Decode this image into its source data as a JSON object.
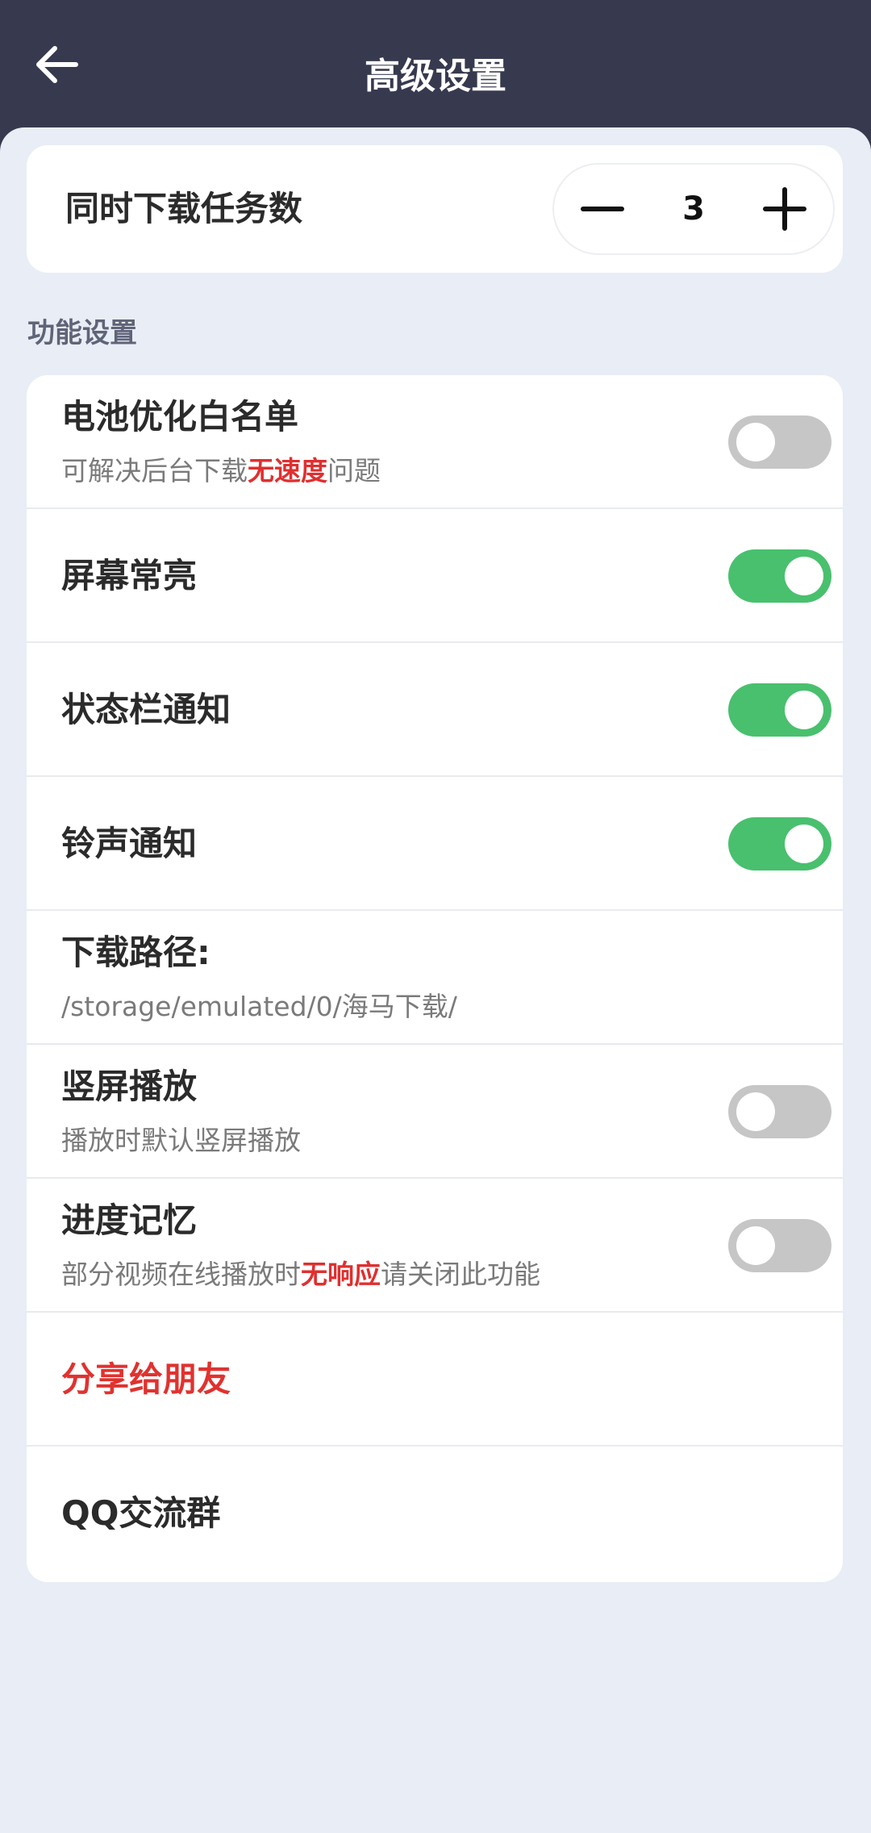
{
  "appbar": {
    "title": "高级设置",
    "back_icon": "arrow-left-icon"
  },
  "concurrent": {
    "label": "同时下载任务数",
    "value": "3",
    "minus_icon": "minus-icon",
    "plus_icon": "plus-icon"
  },
  "section": {
    "title": "功能设置"
  },
  "settings": {
    "battery": {
      "title": "电池优化白名单",
      "sub_before": "可解决后台下载",
      "sub_highlight": "无速度",
      "sub_after": "问题",
      "enabled": false
    },
    "screen_on": {
      "title": "屏幕常亮",
      "enabled": true
    },
    "statusbar": {
      "title": "状态栏通知",
      "enabled": true
    },
    "ringtone": {
      "title": "铃声通知",
      "enabled": true
    },
    "download_path": {
      "title": "下载路径:",
      "value": "/storage/emulated/0/海马下载/"
    },
    "portrait": {
      "title": "竖屏播放",
      "sub": "播放时默认竖屏播放",
      "enabled": false
    },
    "progress_memory": {
      "title": "进度记忆",
      "sub_before": "部分视频在线播放时",
      "sub_highlight": "无响应",
      "sub_after": "请关闭此功能",
      "enabled": false
    },
    "share": {
      "title": "分享给朋友"
    },
    "qq_group": {
      "title": "QQ交流群"
    }
  },
  "colors": {
    "appbar_bg": "#373a4f",
    "toggle_on": "#49c06e",
    "toggle_off": "#c6c6c6",
    "highlight_red": "#e02f2f"
  }
}
